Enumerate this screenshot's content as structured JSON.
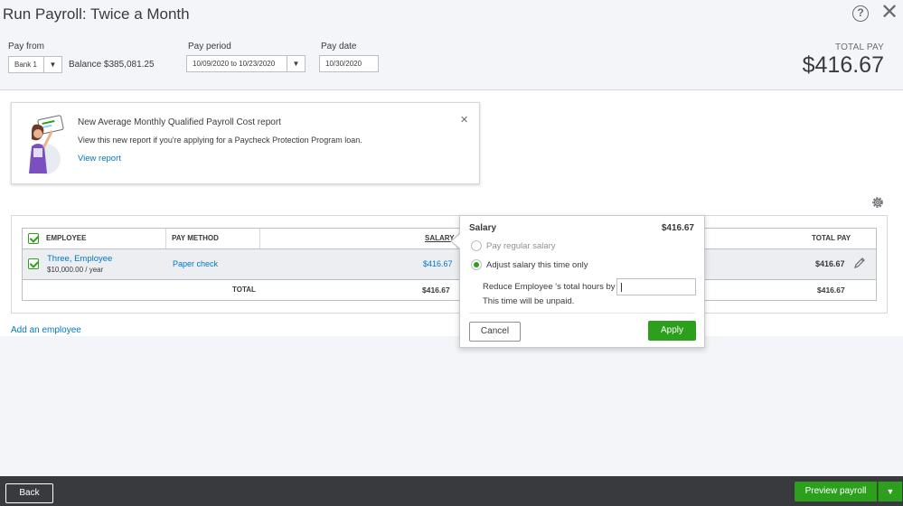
{
  "header": {
    "title": "Run Payroll: Twice a Month",
    "help_icon": "?",
    "close_icon": "✕"
  },
  "pay_from": {
    "label": "Pay from",
    "value": "Bank 1",
    "balance": "Balance $385,081.25"
  },
  "pay_period": {
    "label": "Pay period",
    "value": "10/09/2020 to 10/23/2020"
  },
  "pay_date": {
    "label": "Pay date",
    "value": "10/30/2020"
  },
  "total_pay": {
    "label": "TOTAL PAY",
    "amount": "$416.67"
  },
  "notice": {
    "title": "New Average Monthly Qualified Payroll Cost report",
    "body": "View this new report if you're applying for a Paycheck Protection Program loan.",
    "link": "View report",
    "close": "✕"
  },
  "table": {
    "headers": {
      "employee": "EMPLOYEE",
      "pay_method": "PAY METHOD",
      "salary": "SALARY",
      "total_pay": "TOTAL PAY"
    },
    "rows": [
      {
        "name": "Three, Employee",
        "salary_rate": "$10,000.00 / year",
        "pay_method": "Paper check",
        "salary": "$416.67",
        "total_pay": "$416.67",
        "checked": true
      }
    ],
    "totals": {
      "label": "TOTAL",
      "salary": "$416.67",
      "total_pay": "$416.67"
    }
  },
  "add_employee": "Add an employee",
  "popover": {
    "title": "Salary",
    "amount": "$416.67",
    "option_regular": "Pay regular salary",
    "option_adjust": "Adjust salary this time only",
    "selected": "adjust",
    "reduce_label": "Reduce Employee 's total hours by",
    "hours_value": "",
    "unpaid_note": "This time will be unpaid.",
    "cancel": "Cancel",
    "apply": "Apply"
  },
  "footer": {
    "back": "Back",
    "preview": "Preview payroll",
    "preview_arrow": "▼"
  },
  "colors": {
    "accent": "#2ca01c",
    "link": "#0077c5",
    "footer_bg": "#393a3d"
  },
  "icons": [
    "help-icon",
    "close-icon",
    "chevron-down-icon",
    "gear-icon",
    "pencil-icon",
    "checkbox-icon"
  ]
}
